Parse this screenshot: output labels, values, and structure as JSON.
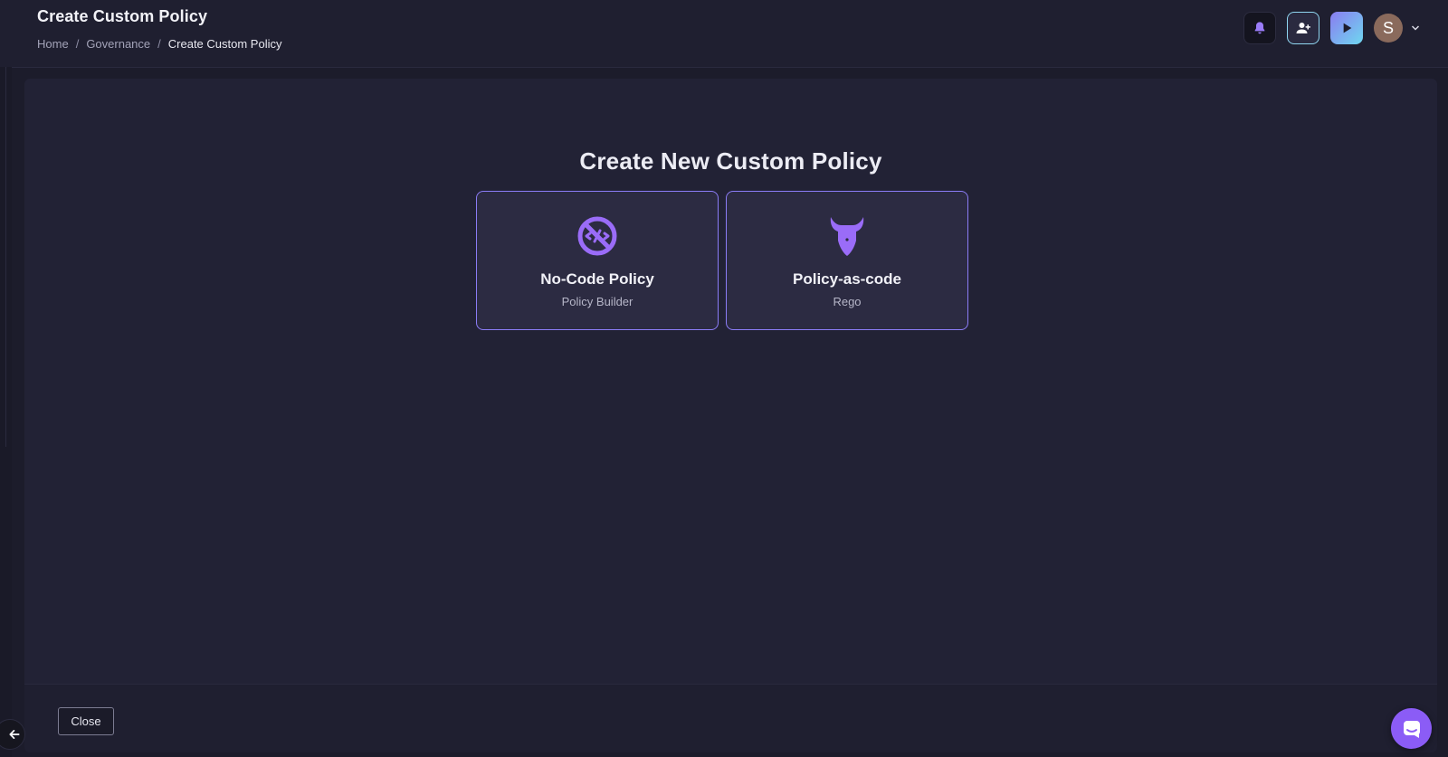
{
  "header": {
    "title": "Create Custom Policy",
    "breadcrumb": [
      "Home",
      "Governance",
      "Create Custom Policy"
    ],
    "breadcrumb_separator": "/",
    "avatar_initial": "S"
  },
  "main": {
    "title": "Create New Custom Policy",
    "cards": [
      {
        "title": "No-Code Policy",
        "subtitle": "Policy Builder",
        "icon": "no-code-icon"
      },
      {
        "title": "Policy-as-code",
        "subtitle": "Rego",
        "icon": "opa-bull-icon"
      }
    ]
  },
  "footer": {
    "close_label": "Close"
  },
  "colors": {
    "accent": "#8b5cf6",
    "card_border": "#8b7cf6",
    "background": "#1c1c2b",
    "panel": "#222235"
  }
}
